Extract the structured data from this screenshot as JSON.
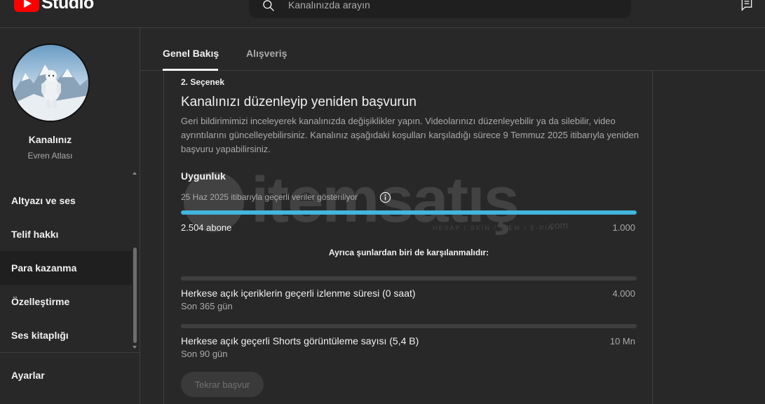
{
  "header": {
    "logo_text": "Studio",
    "search_placeholder": "Kanalınızda arayın"
  },
  "sidebar": {
    "channel_name": "Kanalınız",
    "channel_handle": "Evren Atlası",
    "items": [
      {
        "label": "Altyazı ve ses"
      },
      {
        "label": "Telif hakkı"
      },
      {
        "label": "Para kazanma"
      },
      {
        "label": "Özelleştirme"
      },
      {
        "label": "Ses kitaplığı"
      }
    ],
    "settings_label": "Ayarlar"
  },
  "tabs": [
    {
      "label": "Genel Bakış"
    },
    {
      "label": "Alışveriş"
    }
  ],
  "card": {
    "option_label": "2. Seçenek",
    "title": "Kanalınızı düzenleyip yeniden başvurun",
    "description": "Geri bildirimimizi inceleyerek kanalınızda değişiklikler yapın. Videolarınızı düzenleyebilir ya da silebilir, video ayrıntılarını güncelleyebilirsiniz. Kanalınız aşağıdaki koşulları karşıladığı sürece 9 Temmuz 2025 itibarıyla yeniden başvuru yapabilirsiniz.",
    "eligibility_title": "Uygunluk",
    "eligibility_date": "25 Haz 2025 itibarıyla geçerli veriler gösteriliyor",
    "subscribers": {
      "current": "2.504 abone",
      "target": "1.000",
      "progress": 1.0
    },
    "also_label": "Ayrıca şunlardan biri de karşılanmalıdır:",
    "requirements": [
      {
        "label": "Herkese açık içeriklerin geçerli izlenme süresi (0 saat)",
        "target": "4.000",
        "period": "Son 365 gün",
        "progress": 0.0
      },
      {
        "label": "Herkese açık geçerli Shorts görüntüleme sayısı (5,4 B)",
        "target": "10 Mn",
        "period": "Son 90 gün",
        "progress": 0.0
      }
    ],
    "reapply_label": "Tekrar başvur"
  },
  "watermark": {
    "text": "itemsatış",
    "sub": "HESAP / SKIN / ITEM / E-PIN",
    "com": ".com"
  },
  "colors": {
    "accent": "#41b6df",
    "background": "#282828",
    "brand": "#ff0000"
  }
}
